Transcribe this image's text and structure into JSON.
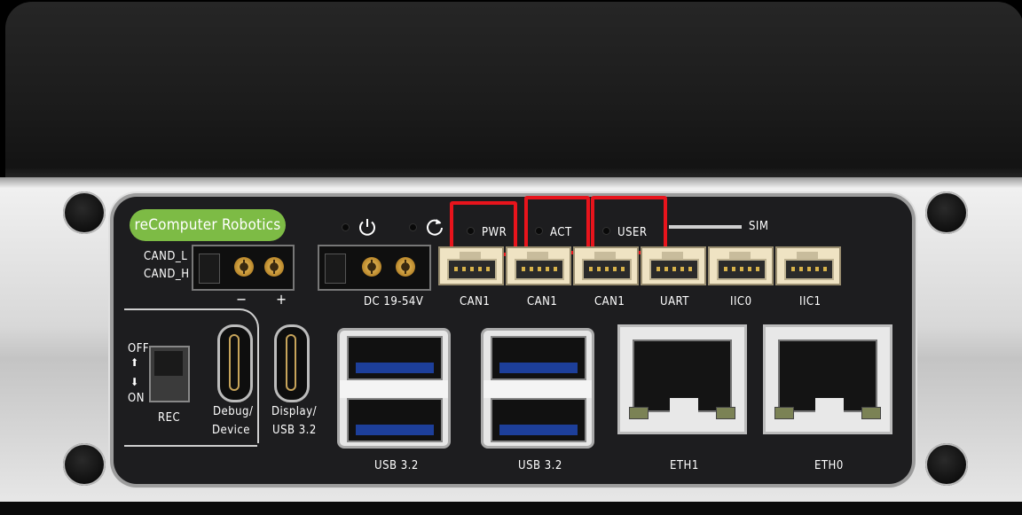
{
  "brand": {
    "label": "reComputer Robotics",
    "color": "#7dbb45"
  },
  "top_leds": {
    "power_button_icon": "power-icon",
    "reset_button_icon": "reset-icon",
    "pwr": "PWR",
    "act": "ACT",
    "user": "USER",
    "sim": "SIM",
    "highlight_color": "#e8141c"
  },
  "can_terminal": {
    "label_l": "CAND_L",
    "label_h": "CAND_H",
    "minus": "−",
    "plus": "+"
  },
  "dc_terminal": {
    "label": "DC 19-54V"
  },
  "jst_ports": [
    "CAN1",
    "CAN1",
    "CAN1",
    "UART",
    "IIC0",
    "IIC1"
  ],
  "rec_switch": {
    "off": "OFF",
    "on": "ON",
    "label": "REC"
  },
  "usb_c_ports": [
    {
      "line1": "Debug/",
      "line2": "Device"
    },
    {
      "line1": "Display/",
      "line2": "USB 3.2"
    }
  ],
  "usb_a_ports": [
    "USB 3.2",
    "USB 3.2"
  ],
  "eth_ports": [
    "ETH1",
    "ETH0"
  ]
}
